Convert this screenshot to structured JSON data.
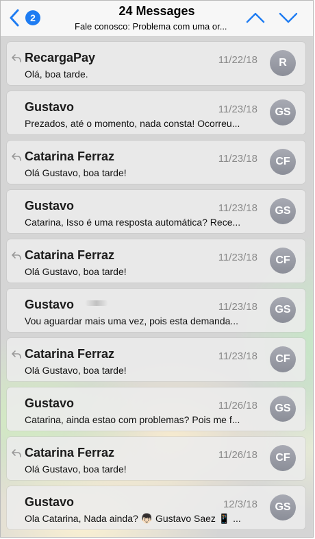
{
  "header": {
    "title": "24 Messages",
    "subtitle": "Fale conosco: Problema com uma or...",
    "back_badge": "2"
  },
  "colors": {
    "accent": "#1e7cf2",
    "avatar": "#9a9ca6"
  },
  "icons": {
    "back": "chevron-left-icon",
    "prev": "chevron-up-icon",
    "next": "chevron-down-icon",
    "reply": "reply-arrow-icon"
  },
  "messages": [
    {
      "sender": "RecargaPay",
      "date": "11/22/18",
      "preview": "Olá, boa tarde.",
      "initials": "R",
      "replied": true
    },
    {
      "sender": "Gustavo",
      "date": "11/23/18",
      "preview": "Prezados, até o momento, nada consta! Ocorreu...",
      "initials": "GS",
      "replied": false
    },
    {
      "sender": "Catarina Ferraz",
      "date": "11/23/18",
      "preview": "Olá Gustavo, boa tarde!",
      "initials": "CF",
      "replied": true
    },
    {
      "sender": "Gustavo",
      "date": "11/23/18",
      "preview": "Catarina, Isso é uma resposta automática? Rece...",
      "initials": "GS",
      "replied": false
    },
    {
      "sender": "Catarina Ferraz",
      "date": "11/23/18",
      "preview": "Olá Gustavo, boa tarde!",
      "initials": "CF",
      "replied": true
    },
    {
      "sender": "Gustavo",
      "date": "11/23/18",
      "preview": "Vou aguardar mais uma vez, pois esta demanda...",
      "initials": "GS",
      "replied": false
    },
    {
      "sender": "Catarina Ferraz",
      "date": "11/23/18",
      "preview": "Olá Gustavo, boa tarde!",
      "initials": "CF",
      "replied": true
    },
    {
      "sender": "Gustavo",
      "date": "11/26/18",
      "preview": "Catarina, ainda estao com problemas? Pois me f...",
      "initials": "GS",
      "replied": false
    },
    {
      "sender": "Catarina Ferraz",
      "date": "11/26/18",
      "preview": "Olá Gustavo, boa tarde!",
      "initials": "CF",
      "replied": true
    },
    {
      "sender": "Gustavo",
      "date": "12/3/18",
      "preview": "Ola Catarina, Nada ainda? 👦🏻 Gustavo Saez 📱 ...",
      "initials": "GS",
      "replied": false
    }
  ]
}
